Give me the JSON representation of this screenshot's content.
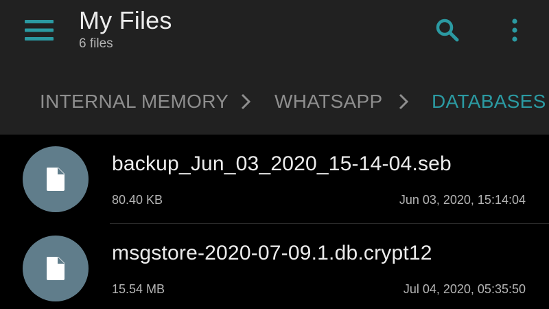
{
  "app": {
    "title": "My Files",
    "subtitle": "6 files"
  },
  "toolbar": {
    "menu_icon": "hamburger-menu-icon",
    "search_icon": "search-icon",
    "more_icon": "more-vertical-icon"
  },
  "breadcrumb": {
    "items": [
      {
        "label": "INTERNAL MEMORY",
        "active": false
      },
      {
        "label": "WHATSAPP",
        "active": false
      },
      {
        "label": "DATABASES",
        "active": true
      }
    ],
    "separator_icon": "chevron-right-icon"
  },
  "files": [
    {
      "name": "backup_Jun_03_2020_15-14-04.seb",
      "size": "80.40 KB",
      "date": "Jun 03, 2020, 15:14:04",
      "icon": "document-icon"
    },
    {
      "name": "msgstore-2020-07-09.1.db.crypt12",
      "size": "15.54 MB",
      "date": "Jul 04, 2020, 05:35:50",
      "icon": "document-icon"
    }
  ],
  "colors": {
    "accent": "#2b9aa2",
    "toolbar_bg": "#212121",
    "list_bg": "#000000",
    "avatar_bg": "#607d8b",
    "primary_text": "#ececec",
    "secondary_text": "#b4b4b4",
    "inactive_crumb": "#8e8e8e"
  }
}
